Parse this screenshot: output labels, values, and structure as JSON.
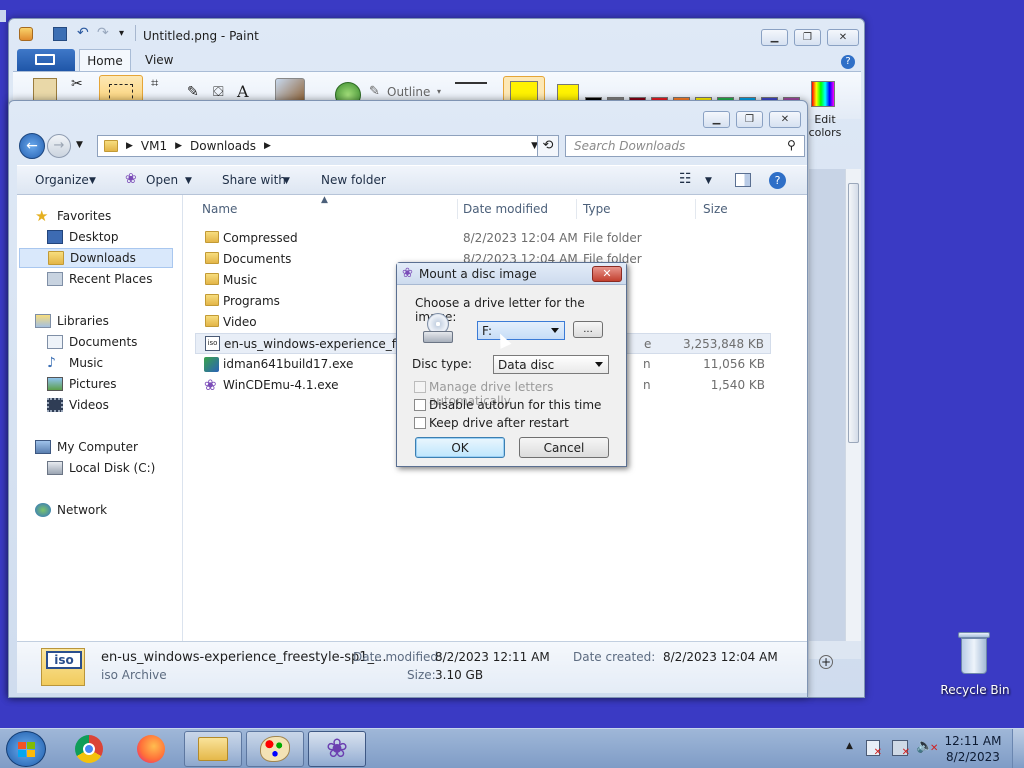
{
  "paint": {
    "title": "Untitled.png - Paint",
    "tabs": [
      "Home",
      "View"
    ],
    "outline_label": "Outline",
    "edit_colors_label": "Edit\ncolors",
    "palette": [
      "#000000",
      "#7f7f7f",
      "#880015",
      "#ed1c24",
      "#ff7f27",
      "#fff200",
      "#22b14c",
      "#00a2e8",
      "#3f48cc",
      "#a349a4"
    ],
    "color1": "#fff200",
    "color2": "#fff200"
  },
  "explorer": {
    "breadcrumb": [
      "VM1",
      "Downloads"
    ],
    "search_placeholder": "Search Downloads",
    "commands": {
      "organize": "Organize",
      "open": "Open",
      "share_with": "Share with",
      "new_folder": "New folder"
    },
    "sidebar": {
      "favorites": "Favorites",
      "desktop": "Desktop",
      "downloads": "Downloads",
      "recent_places": "Recent Places",
      "libraries": "Libraries",
      "documents": "Documents",
      "music": "Music",
      "pictures": "Pictures",
      "videos": "Videos",
      "my_computer": "My Computer",
      "local_disk": "Local Disk (C:)",
      "network": "Network"
    },
    "columns": {
      "name": "Name",
      "date_modified": "Date modified",
      "type": "Type",
      "size": "Size"
    },
    "rows": [
      {
        "name": "Compressed",
        "date": "8/2/2023 12:04 AM",
        "type": "File folder",
        "size": ""
      },
      {
        "name": "Documents",
        "date": "8/2/2023 12:04 AM",
        "type": "File folder",
        "size": ""
      },
      {
        "name": "Music",
        "date": "",
        "type": "",
        "size": ""
      },
      {
        "name": "Programs",
        "date": "",
        "type": "",
        "size": ""
      },
      {
        "name": "Video",
        "date": "",
        "type": "",
        "size": ""
      },
      {
        "name": "en-us_windows-experience_freesty",
        "date": "",
        "type": "e",
        "size": "3,253,848 KB"
      },
      {
        "name": "idman641build17.exe",
        "date": "",
        "type": "n",
        "size": "11,056 KB"
      },
      {
        "name": "WinCDEmu-4.1.exe",
        "date": "",
        "type": "n",
        "size": "1,540 KB"
      }
    ],
    "details": {
      "filename": "en-us_windows-experience_freestyle-sp1_...",
      "filetype": "iso Archive",
      "date_modified_label": "Date modified:",
      "date_modified": "8/2/2023 12:11 AM",
      "date_created_label": "Date created:",
      "date_created": "8/2/2023 12:04 AM",
      "size_label": "Size:",
      "size": "3.10 GB",
      "thumb_text": "iso"
    }
  },
  "dialog": {
    "title": "Mount a disc image",
    "prompt": "Choose a drive letter for the image:",
    "drive_letter": "F:",
    "browse_label": "...",
    "disc_type_label": "Disc type:",
    "disc_type": "Data disc",
    "manage_letters": "Manage drive letters automatically",
    "disable_autorun": "Disable autorun for this time",
    "keep_drive": "Keep drive after restart",
    "ok": "OK",
    "cancel": "Cancel"
  },
  "desktop": {
    "recycle_bin": "Recycle Bin"
  },
  "taskbar": {
    "time": "12:11 AM",
    "date": "8/2/2023"
  }
}
